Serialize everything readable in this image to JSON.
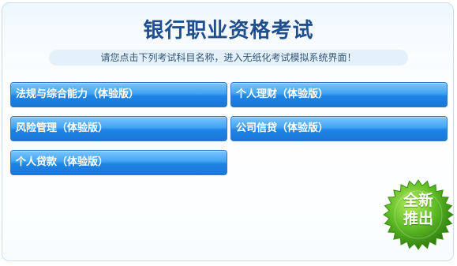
{
  "header": {
    "title": "银行职业资格考试",
    "subtitle": "请您点击下列考试科目名称，进入无纸化考试模拟系统界面！"
  },
  "exams": [
    {
      "label": "法规与综合能力（体验版）"
    },
    {
      "label": "个人理财（体验版）"
    },
    {
      "label": "风险管理（体验版）"
    },
    {
      "label": "公司信贷（体验版）"
    },
    {
      "label": "个人贷款（体验版）"
    }
  ],
  "badge": {
    "line1": "全新",
    "line2": "推出",
    "color": "#4aa51c"
  },
  "colors": {
    "title": "#1f4f8f",
    "button": "#1e84e6"
  }
}
